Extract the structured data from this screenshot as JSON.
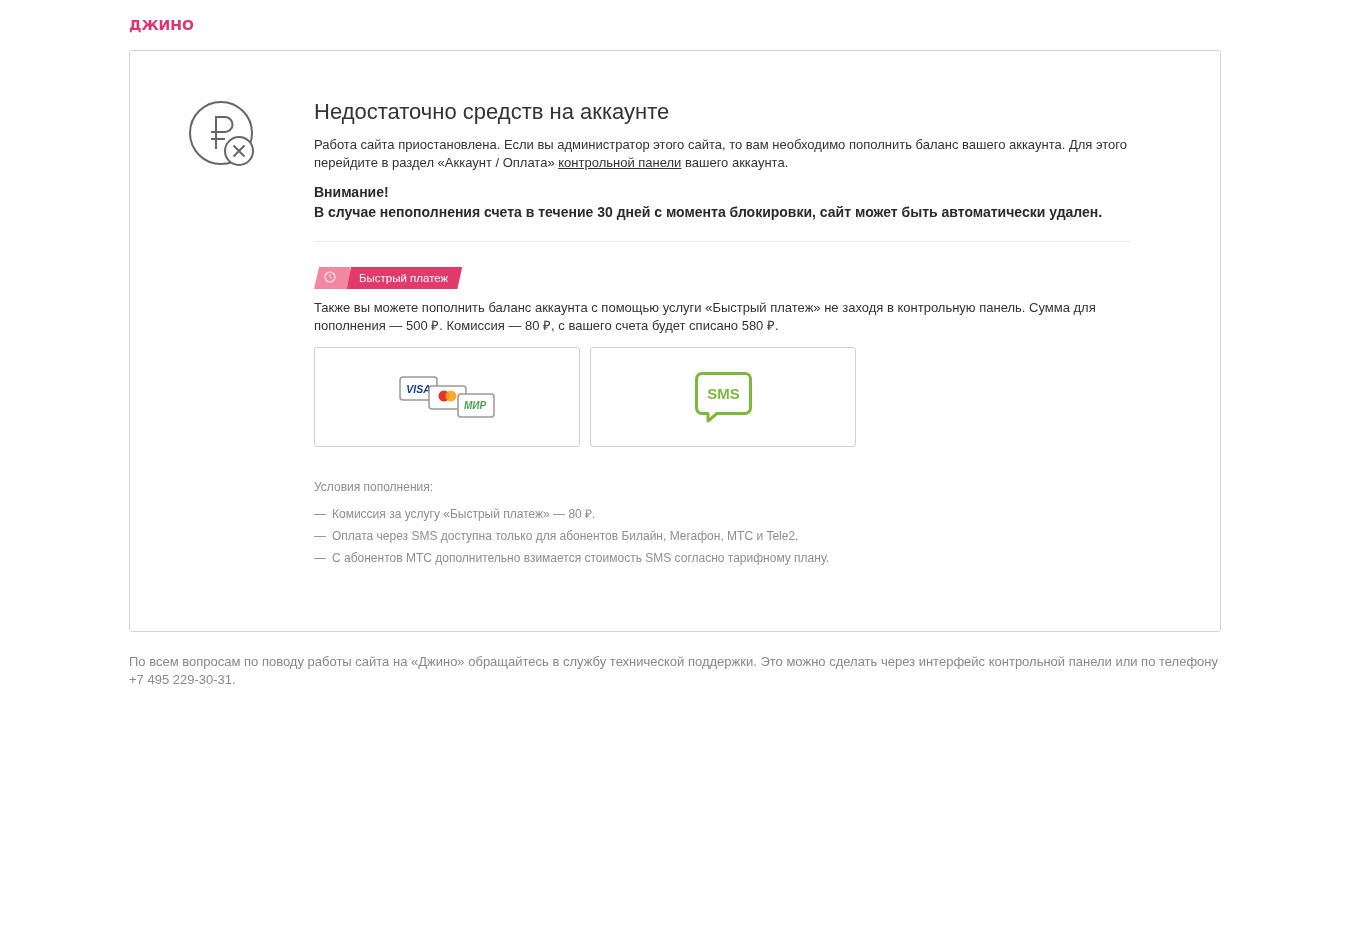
{
  "logo": "ДЖИНО",
  "notice": {
    "title": "Недостаточно средств на аккаунте",
    "description": {
      "text": "Работа сайта приостановлена. Если вы администратор этого сайта, то вам необходимо пополнить баланс вашего аккаунта. Для этого перейдите в раздел «Аккаунт / Оплата» ",
      "link": "контрольной панели",
      "after": " вашего аккаунта."
    },
    "warning_title": "Внимание!",
    "warning_text": "В случае непополнения счета в течение 30 дней с момента блокировки, сайт может быть автоматически удален."
  },
  "quick_pay": {
    "badge": "Быстрый платеж",
    "description": "Также вы можете пополнить баланс аккаунта с помощью услуги «Быстрый платеж» не заходя в контрольную панель. Сумма для пополнения — 500 ₽. Комиссия — 80 ₽, с вашего счета будет списано 580 ₽.",
    "options": [
      {
        "kind": "cards",
        "labels": [
          "VISA",
          "МИР"
        ]
      },
      {
        "kind": "sms",
        "labels": [
          "SMS"
        ]
      }
    ],
    "conditions_title": "Условия пополнения:",
    "conditions": [
      {
        "marker": "—",
        "text": "Комиссия за услугу «Быстрый платеж» — 80 ₽."
      },
      {
        "marker": "—",
        "text": "Оплата через SMS доступна только для абонентов Билайн, Мегафон, МТС и Tele2."
      },
      {
        "marker": "—",
        "text": "С абонентов МТС дополнительно взимается стоимость SMS согласно тарифному плану."
      }
    ]
  },
  "footer": "По всем вопросам по поводу работы сайта на «Джино» обращайтесь в службу технической поддержки. Это можно сделать через интерфейс контрольной панели или по телефону +7 495 229-30-31."
}
